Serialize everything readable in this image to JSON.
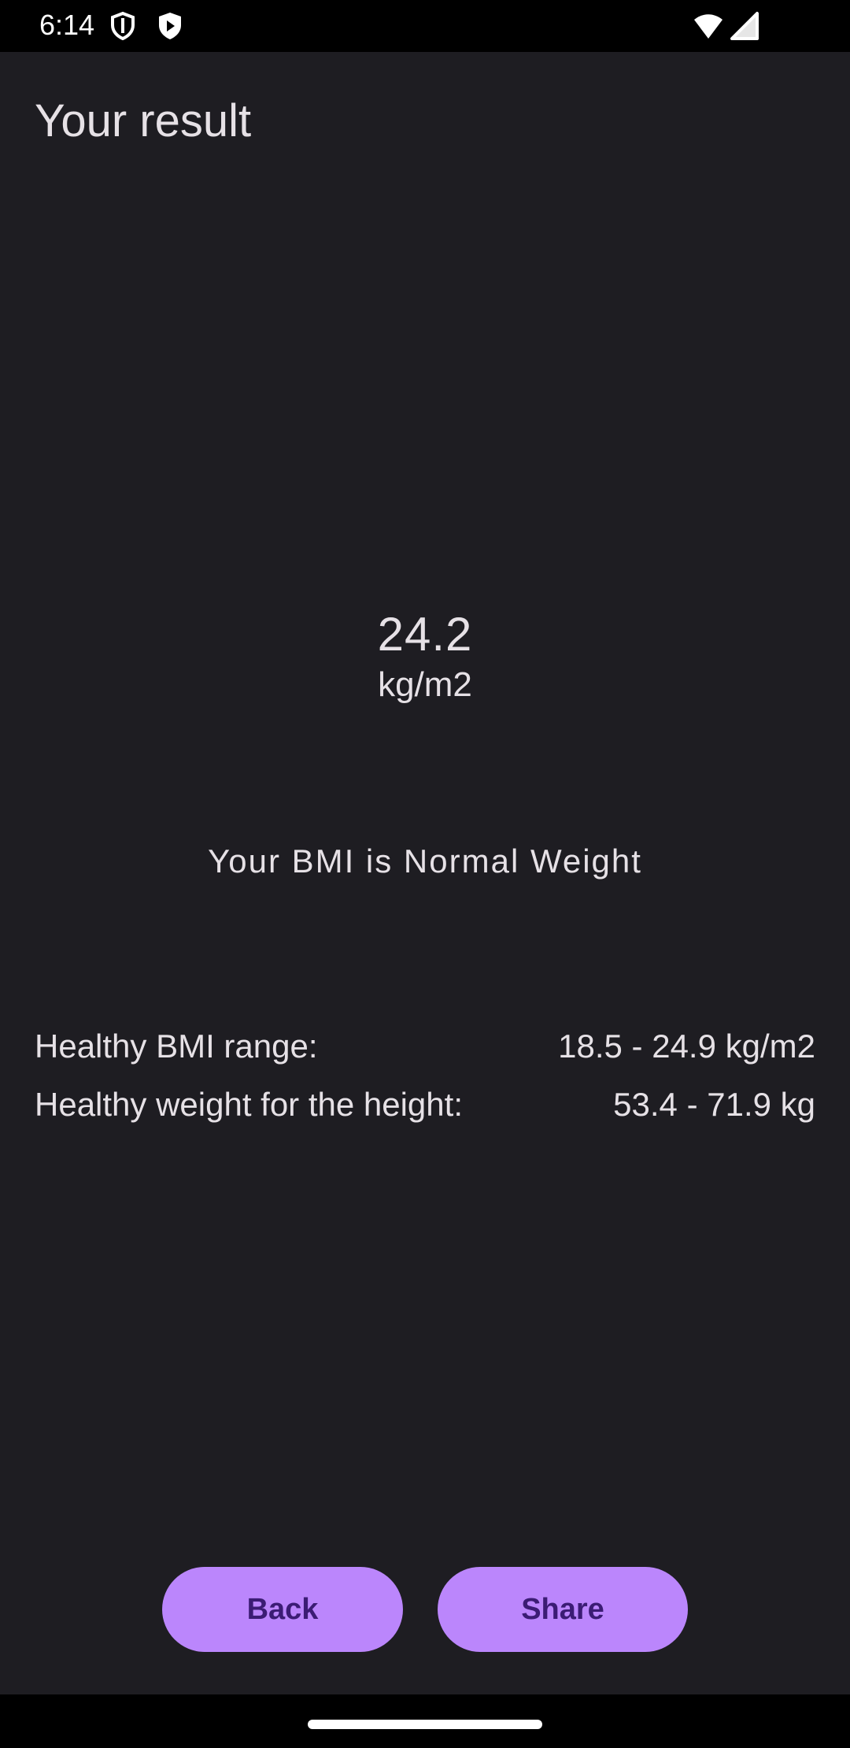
{
  "status_bar": {
    "time": "6:14",
    "icons": [
      "shield-icon",
      "play-shield-icon",
      "wifi-icon",
      "cellular-signal-icon"
    ]
  },
  "header": {
    "title": "Your result"
  },
  "result": {
    "bmi_value": "24.2",
    "bmi_unit": "kg/m2",
    "category_text": "Your BMI is Normal Weight"
  },
  "details": {
    "range_label": "Healthy BMI range:",
    "range_value": "18.5 - 24.9 kg/m2",
    "weight_label": "Healthy weight for the height:",
    "weight_value": "53.4 - 71.9 kg"
  },
  "actions": {
    "back_label": "Back",
    "share_label": "Share"
  },
  "colors": {
    "background": "#1e1d22",
    "button": "#bb86fc",
    "button_text": "#3b1c74",
    "text": "#e6e1e6"
  }
}
